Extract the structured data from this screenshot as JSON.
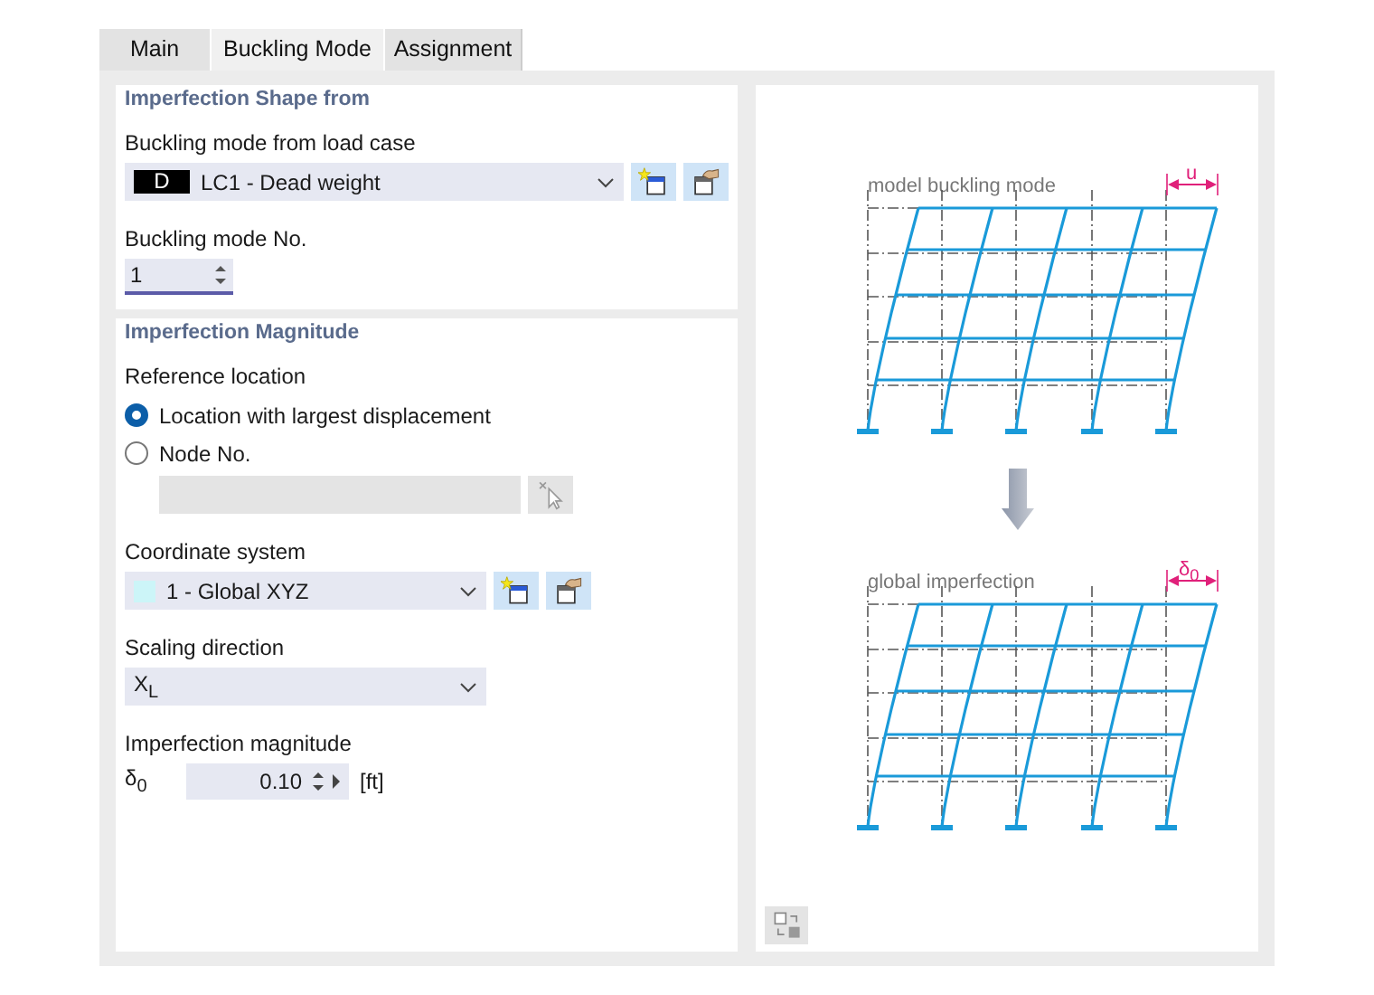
{
  "tabs": [
    {
      "label": "Main",
      "selected": false
    },
    {
      "label": "Buckling Mode",
      "selected": true
    },
    {
      "label": "Assignment",
      "selected": false
    }
  ],
  "shape_section": {
    "title": "Imperfection Shape from",
    "load_case": {
      "label": "Buckling mode from load case",
      "badge": "D",
      "value": "LC1 - Dead weight"
    },
    "mode_no": {
      "label": "Buckling mode No.",
      "value": "1"
    }
  },
  "magnitude_section": {
    "title": "Imperfection Magnitude",
    "reference": {
      "label": "Reference location",
      "options": [
        {
          "label": "Location with largest displacement",
          "selected": true
        },
        {
          "label": "Node No.",
          "selected": false
        }
      ],
      "node_field": {
        "disabled": true
      }
    },
    "coordinate_system": {
      "label": "Coordinate system",
      "value": "1 - Global XYZ",
      "color": "#ccf5f8"
    },
    "scaling_direction": {
      "label": "Scaling direction",
      "value": "X$_{L}$"
    },
    "magnitude": {
      "label": "Imperfection magnitude",
      "symbol": "δ$_{0}$",
      "value": "0.10",
      "unit": "[ft]"
    }
  },
  "diagram": {
    "top_label": "model buckling mode",
    "top_dim": "u",
    "bottom_label": "global imperfection",
    "bottom_dim": "δ$_{0}$"
  }
}
